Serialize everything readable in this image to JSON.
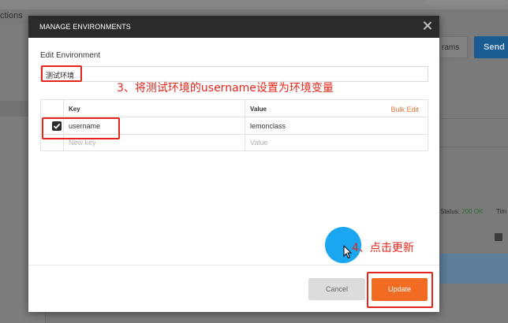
{
  "background": {
    "sidebar_tab_partial": "ctions",
    "params_button_partial": "rams",
    "send_label": "Send",
    "status_label": "Status:",
    "status_value": "200 OK",
    "time_partial": "Tim"
  },
  "modal": {
    "title": "MANAGE ENVIRONMENTS",
    "edit_label": "Edit Environment",
    "environment_name": "测试环境",
    "table": {
      "headers": {
        "key": "Key",
        "value": "Value",
        "bulk_edit": "Bulk Edit"
      },
      "rows": [
        {
          "checked": true,
          "key": "username",
          "value": "lemonclass"
        }
      ],
      "new_row": {
        "key_placeholder": "New key",
        "value_placeholder": "Value"
      }
    },
    "cancel_label": "Cancel",
    "update_label": "Update"
  },
  "annotations": {
    "step3": "3、将测试环境的username设置为环境变量",
    "step4": "4、点击更新"
  },
  "colors": {
    "accent_orange": "#f26b22",
    "annotation_red": "#e3261b",
    "click_indicator": "#1aa6f0",
    "send_blue": "#1b5d92"
  }
}
